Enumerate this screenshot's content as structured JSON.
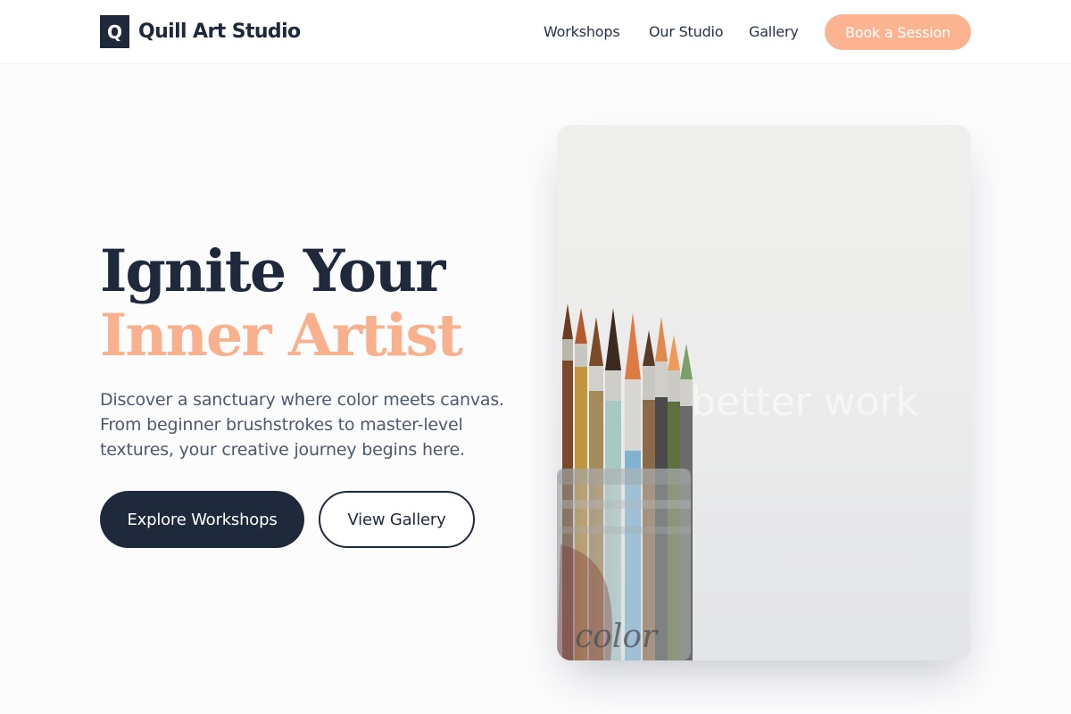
{
  "brand": {
    "logo_letter": "Q",
    "name": "Quill Art Studio"
  },
  "nav": {
    "links": [
      {
        "label": "Workshops"
      },
      {
        "label": "Our Studio"
      },
      {
        "label": "Gallery"
      }
    ],
    "cta_label": "Book a Session"
  },
  "hero": {
    "title_line1": "Ignite Your",
    "title_line2": "Inner Artist",
    "description": "Discover a sanctuary where color meets canvas. From beginner brushstrokes to master-level textures, your creative journey begins here.",
    "primary_button": "Explore Workshops",
    "secondary_button": "View Gallery",
    "image": {
      "subject": "jar of paintbrushes",
      "watermark_text": "better work",
      "jar_script": "color"
    }
  },
  "colors": {
    "brand_dark": "#1e293b",
    "accent_peach": "#fbb390",
    "body_text": "#4d596c"
  }
}
